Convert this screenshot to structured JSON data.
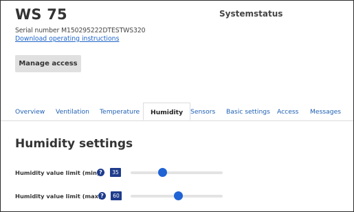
{
  "device": {
    "title": "WS 75",
    "serial": "Serial number M150295222DTESTWS320",
    "download_link": "Download operating instructions",
    "manage_access": "Manage access",
    "system_status": "Systemstatus"
  },
  "tabs": [
    {
      "label": "Overview",
      "active": false
    },
    {
      "label": "Ventilation",
      "active": false
    },
    {
      "label": "Temperature",
      "active": false
    },
    {
      "label": "Humidity",
      "active": true
    },
    {
      "label": "Sensors",
      "active": false
    },
    {
      "label": "Basic settings",
      "active": false
    },
    {
      "label": "Access",
      "active": false
    },
    {
      "label": "Messages",
      "active": false
    }
  ],
  "humidity": {
    "heading": "Humidity settings",
    "min": {
      "label": "Humidity value limit (min)",
      "help": "?",
      "value": "35",
      "slider_fraction": 0.35
    },
    "max": {
      "label": "Humidity value limit (max)",
      "help": "?",
      "value": "60",
      "slider_fraction": 0.52
    }
  },
  "colors": {
    "accent": "#1e3c8c",
    "link": "#1e64c8",
    "slider_thumb": "#1f63d4"
  }
}
